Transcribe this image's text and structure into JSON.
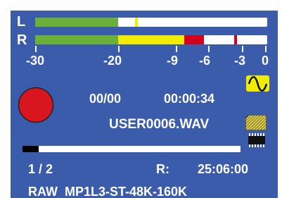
{
  "meter": {
    "left_channel_label": "L",
    "right_channel_label": "R",
    "left": {
      "green_fill_pct": 35.9,
      "peak_pct": 43.1
    },
    "right": {
      "green_fill_pct": 35.9,
      "yellow_fill_pct": 64.1,
      "red_fill_pct": 72.7,
      "peak_pct": 85.9
    },
    "scale_labels": [
      "-30",
      "-20",
      "-9",
      "-6",
      "-3",
      "0"
    ],
    "colors": {
      "green": "#6ab03a",
      "yellow": "#f2ec00",
      "red": "#d4001b"
    }
  },
  "status": {
    "file_counter": "00/00",
    "elapsed_time": "00:00:34",
    "file_name": "USER0006.WAV",
    "page_indicator": "1 / 2",
    "remaining_label": "R:",
    "remaining_time": "25:06:00",
    "recording_format": "RAW  MP1L3-ST-48K-160K"
  },
  "progress": {
    "fraction": 0.075
  },
  "icons": {
    "record": "record-indicator-icon",
    "signal": "sine-wave-icon",
    "media": "sd-card-icon",
    "memory": "memory-chip-icon"
  },
  "colors": {
    "background": "#3b5bab",
    "record_red": "#d7161f",
    "accent_yellow": "#f2ec00"
  }
}
